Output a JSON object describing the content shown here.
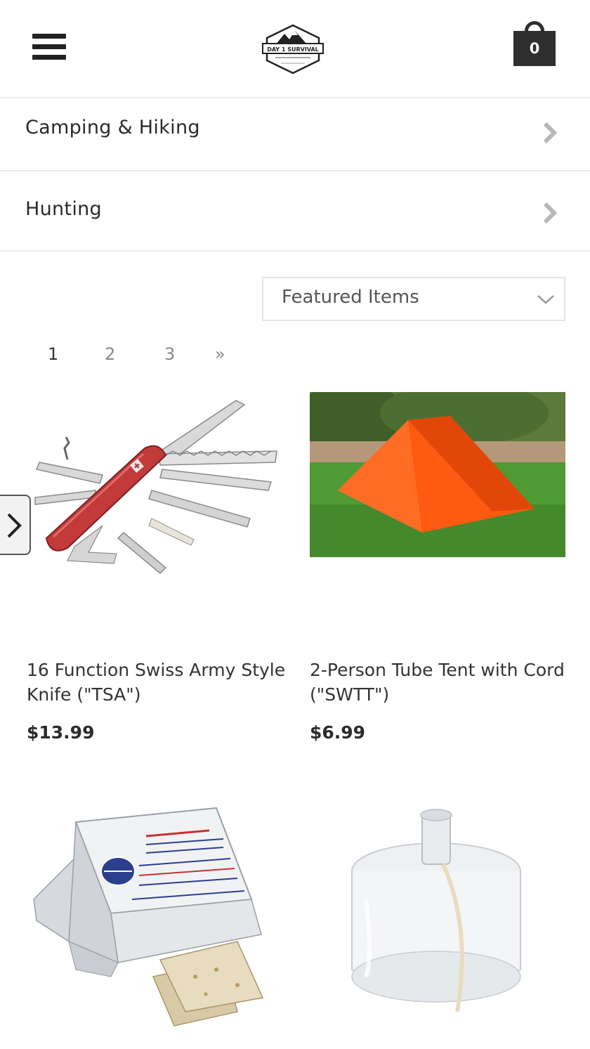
{
  "header": {
    "menu_icon": "hamburger-menu-icon",
    "logo_alt": "DAY 1 SURVIVAL",
    "cart_count": "0"
  },
  "categories": [
    {
      "label": "Camping & Hiking",
      "icon": "chevron-right-icon"
    },
    {
      "label": "Hunting",
      "icon": "chevron-right-icon"
    }
  ],
  "sort": {
    "selected": "Featured Items",
    "icon": "chevron-down-icon"
  },
  "pagination": {
    "pages": [
      "1",
      "2",
      "3"
    ],
    "current": "1",
    "next_label": "»"
  },
  "products": [
    {
      "title": "16 Function Swiss Army Style Knife (\"TSA\")",
      "price": "$13.99",
      "image": "swiss-army-knife"
    },
    {
      "title": "2-Person Tube Tent with Cord (\"SWTT\")",
      "price": "$6.99",
      "image": "orange-tube-tent"
    },
    {
      "title": "",
      "price": "",
      "image": "emergency-food-bar"
    },
    {
      "title": "",
      "price": "",
      "image": "glass-oil-candle"
    }
  ],
  "colors": {
    "text": "#2b2b2b",
    "muted": "#888888",
    "divider": "#ececec",
    "cart_bg": "#2e2e2e",
    "tent": "#ff5a12"
  }
}
